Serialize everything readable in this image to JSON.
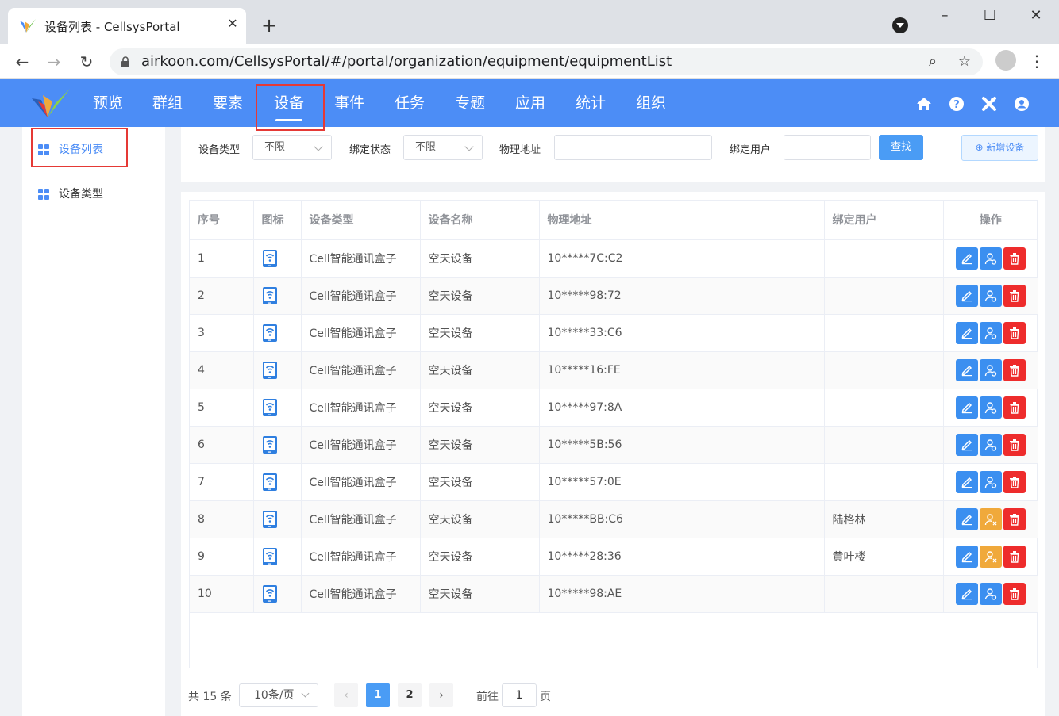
{
  "browser": {
    "tab_title": "设备列表 - CellsysPortal",
    "url": "airkoon.com/CellsysPortal/#/portal/organization/equipment/equipmentList"
  },
  "topnav": {
    "items": [
      "预览",
      "群组",
      "要素",
      "设备",
      "事件",
      "任务",
      "专题",
      "应用",
      "统计",
      "组织"
    ],
    "active": "设备"
  },
  "sidebar": {
    "items": [
      "设备列表",
      "设备类型"
    ],
    "active": "设备列表"
  },
  "filters": {
    "device_type_label": "设备类型",
    "device_type_value": "不限",
    "bind_status_label": "绑定状态",
    "bind_status_value": "不限",
    "mac_label": "物理地址",
    "bind_user_label": "绑定用户",
    "search_label": "查找",
    "add_label": "新增设备"
  },
  "table": {
    "headers": [
      "序号",
      "图标",
      "设备类型",
      "设备名称",
      "物理地址",
      "绑定用户",
      "操作"
    ],
    "rows": [
      {
        "no": "1",
        "type": "Cell智能通讯盒子",
        "name": "空天设备",
        "mac": "10*****7C:C2",
        "user": ""
      },
      {
        "no": "2",
        "type": "Cell智能通讯盒子",
        "name": "空天设备",
        "mac": "10*****98:72",
        "user": ""
      },
      {
        "no": "3",
        "type": "Cell智能通讯盒子",
        "name": "空天设备",
        "mac": "10*****33:C6",
        "user": ""
      },
      {
        "no": "4",
        "type": "Cell智能通讯盒子",
        "name": "空天设备",
        "mac": "10*****16:FE",
        "user": ""
      },
      {
        "no": "5",
        "type": "Cell智能通讯盒子",
        "name": "空天设备",
        "mac": "10*****97:8A",
        "user": ""
      },
      {
        "no": "6",
        "type": "Cell智能通讯盒子",
        "name": "空天设备",
        "mac": "10*****5B:56",
        "user": ""
      },
      {
        "no": "7",
        "type": "Cell智能通讯盒子",
        "name": "空天设备",
        "mac": "10*****57:0E",
        "user": ""
      },
      {
        "no": "8",
        "type": "Cell智能通讯盒子",
        "name": "空天设备",
        "mac": "10*****BB:C6",
        "user": "陆格林"
      },
      {
        "no": "9",
        "type": "Cell智能通讯盒子",
        "name": "空天设备",
        "mac": "10*****28:36",
        "user": "黄叶楼"
      },
      {
        "no": "10",
        "type": "Cell智能通讯盒子",
        "name": "空天设备",
        "mac": "10*****98:AE",
        "user": ""
      }
    ]
  },
  "pagination": {
    "total": "共 15 条",
    "page_size": "10条/页",
    "pages": [
      "1",
      "2"
    ],
    "current": "1",
    "goto_prefix": "前往",
    "goto_value": "1",
    "goto_suffix": "页"
  },
  "icons": {
    "row_device": "wifi-device-icon",
    "edit": "pencil-icon",
    "bind": "user-link-icon",
    "unbind": "user-unlink-icon",
    "delete": "trash-icon",
    "topnav_right": [
      "home-icon",
      "help-icon",
      "tools-icon",
      "user-icon"
    ]
  },
  "colors": {
    "primary": "#4c8df6",
    "button_blue": "#3b8ff0",
    "button_orange": "#f0a93b",
    "button_red": "#ee2c2c",
    "highlight_box": "#e53935"
  }
}
